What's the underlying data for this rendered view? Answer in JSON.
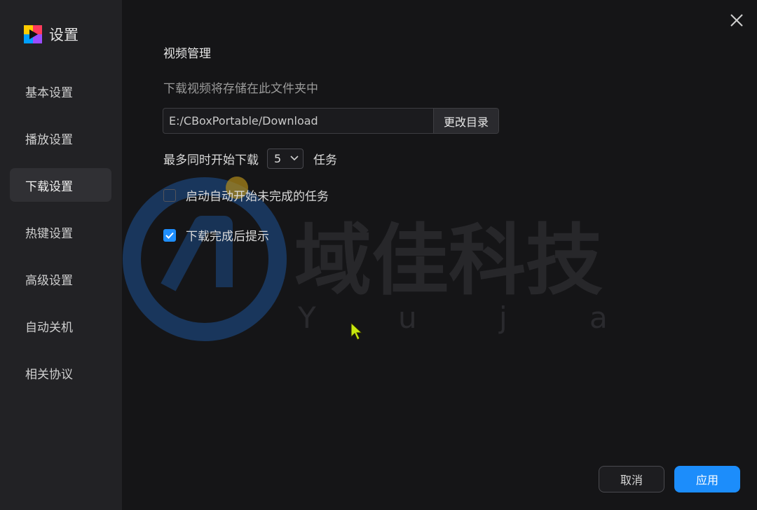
{
  "app": {
    "title": "设置",
    "logo_icon": "cbox-logo-icon"
  },
  "sidebar": {
    "items": [
      {
        "label": "基本设置",
        "active": false
      },
      {
        "label": "播放设置",
        "active": false
      },
      {
        "label": "下载设置",
        "active": true
      },
      {
        "label": "热键设置",
        "active": false
      },
      {
        "label": "高级设置",
        "active": false
      },
      {
        "label": "自动关机",
        "active": false
      },
      {
        "label": "相关协议",
        "active": false
      }
    ]
  },
  "main": {
    "section_title": "视频管理",
    "folder_hint": "下载视频将存储在此文件夹中",
    "download_path": "E:/CBoxPortable/Download",
    "change_dir_label": "更改目录",
    "max_tasks_prefix": "最多同时开始下载",
    "max_tasks_value": "5",
    "max_tasks_suffix": "任务",
    "auto_start_label": "启动自动开始未完成的任务",
    "auto_start_checked": false,
    "notify_label": "下载完成后提示",
    "notify_checked": true
  },
  "watermark": {
    "text": "域佳科技",
    "subtext": "Y u j a"
  },
  "footer": {
    "cancel_label": "取消",
    "apply_label": "应用"
  },
  "colors": {
    "accent": "#1c8dfb",
    "sidebar_bg": "#222225",
    "content_bg": "#151517",
    "active_item_bg": "#303034"
  }
}
